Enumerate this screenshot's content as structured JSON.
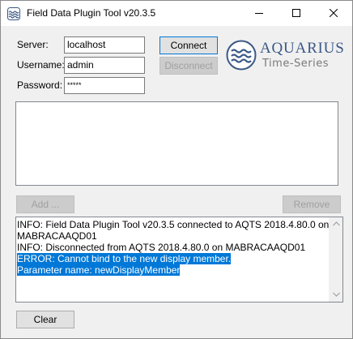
{
  "window": {
    "title": "Field Data Plugin Tool v20.3.5"
  },
  "connection": {
    "server_label": "Server:",
    "server_value": "localhost",
    "username_label": "Username:",
    "username_value": "admin",
    "password_label": "Password:",
    "password_value": "*****",
    "connect_label": "Connect",
    "disconnect_label": "Disconnect"
  },
  "logo": {
    "line1": "AQUARIUS",
    "line2": "Time-Series",
    "color": "#3a5886"
  },
  "plugins": {
    "items": [],
    "add_label": "Add ...",
    "remove_label": "Remove"
  },
  "log": {
    "lines": [
      {
        "text": "INFO: Field Data Plugin Tool v20.3.5 connected to AQTS 2018.4.80.0 on",
        "selected": false
      },
      {
        "text": "MABRACAAQD01",
        "selected": false
      },
      {
        "text": "INFO: Disconnected from AQTS 2018.4.80.0 on MABRACAAQD01",
        "selected": false
      },
      {
        "text": "ERROR: Cannot bind to the new display member.",
        "selected": true
      },
      {
        "text": "Parameter name: newDisplayMember",
        "selected": true
      }
    ],
    "clear_label": "Clear",
    "selection_color": "#0078d7"
  }
}
